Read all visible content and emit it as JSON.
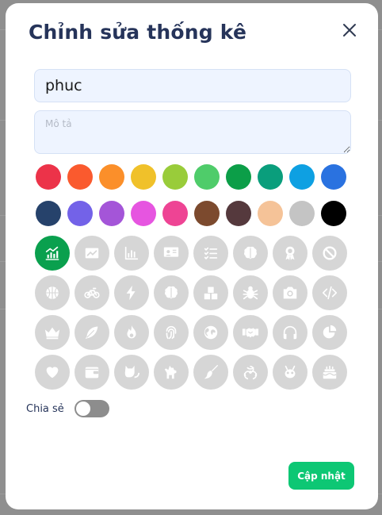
{
  "modal": {
    "title": "Chỉnh sửa thống kê",
    "close_icon": "close-icon"
  },
  "form": {
    "name_value": "phuc",
    "name_placeholder": "",
    "description_value": "",
    "description_placeholder": "Mô tả"
  },
  "colors": {
    "row1": [
      "#ec3349",
      "#fa5a2e",
      "#fb8f2a",
      "#f0c12a",
      "#99cc3a",
      "#4fcc6a",
      "#0c9e48",
      "#0a9e7c",
      "#0ea0e2",
      "#2a72e0"
    ],
    "row2": [
      "#26426b",
      "#7362e8",
      "#a455d8",
      "#e655e0",
      "#ee4494",
      "#7c4a2e",
      "#55393d",
      "#f5c398",
      "#c4c4c4",
      "#000000"
    ]
  },
  "icons": [
    {
      "name": "bar-chart-trend-icon",
      "selected": true
    },
    {
      "name": "line-chart-icon",
      "selected": false
    },
    {
      "name": "bar-chart-icon",
      "selected": false
    },
    {
      "name": "presentation-icon",
      "selected": false
    },
    {
      "name": "checklist-icon",
      "selected": false
    },
    {
      "name": "brain-icon",
      "selected": false
    },
    {
      "name": "award-icon",
      "selected": false
    },
    {
      "name": "ban-icon",
      "selected": false
    },
    {
      "name": "basketball-icon",
      "selected": false
    },
    {
      "name": "bicycle-icon",
      "selected": false
    },
    {
      "name": "lightning-icon",
      "selected": false
    },
    {
      "name": "brain-icon",
      "selected": false
    },
    {
      "name": "boxes-icon",
      "selected": false
    },
    {
      "name": "bug-icon",
      "selected": false
    },
    {
      "name": "camera-icon",
      "selected": false
    },
    {
      "name": "code-icon",
      "selected": false
    },
    {
      "name": "crown-icon",
      "selected": false
    },
    {
      "name": "feather-icon",
      "selected": false
    },
    {
      "name": "fire-icon",
      "selected": false
    },
    {
      "name": "fingerprint-icon",
      "selected": false
    },
    {
      "name": "globe-icon",
      "selected": false
    },
    {
      "name": "handshake-icon",
      "selected": false
    },
    {
      "name": "headphones-icon",
      "selected": false
    },
    {
      "name": "pie-chart-icon",
      "selected": false
    },
    {
      "name": "heart-icon",
      "selected": false
    },
    {
      "name": "wallet-icon",
      "selected": false
    },
    {
      "name": "cat-icon",
      "selected": false
    },
    {
      "name": "dog-icon",
      "selected": false
    },
    {
      "name": "broom-icon",
      "selected": false
    },
    {
      "name": "biohazard-icon",
      "selected": false
    },
    {
      "name": "alien-icon",
      "selected": false
    },
    {
      "name": "cake-icon",
      "selected": false
    }
  ],
  "share": {
    "label": "Chia sẻ",
    "enabled": false
  },
  "actions": {
    "update_label": "Cập nhật"
  }
}
